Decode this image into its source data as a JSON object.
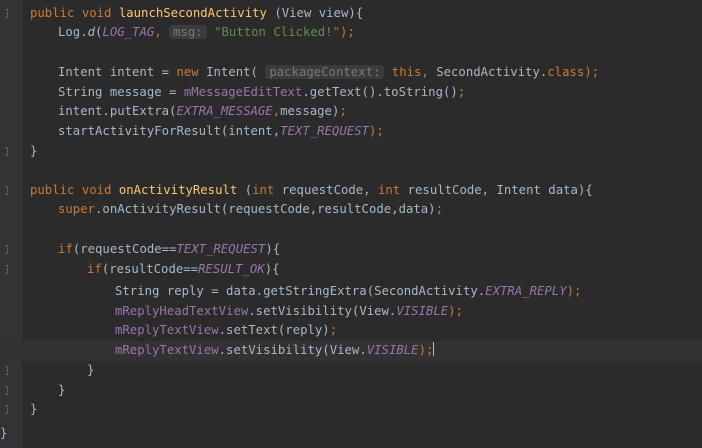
{
  "editor": {
    "lines": [
      [
        {
          "t": "public void ",
          "c": "kw"
        },
        {
          "t": "launchSecondActivity",
          "c": "fn"
        },
        {
          "t": " (View view){",
          "c": "text"
        }
      ],
      [
        {
          "t": "Log.",
          "c": "text"
        },
        {
          "t": "d",
          "c": "ital"
        },
        {
          "t": "(",
          "c": "text"
        },
        {
          "t": "LOG_TAG",
          "c": "const"
        },
        {
          "t": ", ",
          "c": "kw"
        },
        {
          "t": "msg:",
          "c": "hint"
        },
        {
          "t": " ",
          "c": "text"
        },
        {
          "t": "\"Button Clicked!\"",
          "c": "str"
        },
        {
          "t": ");",
          "c": "kw"
        }
      ],
      [],
      [
        {
          "t": "Intent intent = ",
          "c": "text"
        },
        {
          "t": "new ",
          "c": "kw"
        },
        {
          "t": "Intent( ",
          "c": "text"
        },
        {
          "t": "packageContext:",
          "c": "hint"
        },
        {
          "t": " ",
          "c": "text"
        },
        {
          "t": "this, ",
          "c": "kw"
        },
        {
          "t": "SecondActivity.",
          "c": "text"
        },
        {
          "t": "class",
          "c": "kw"
        },
        {
          "t": ");",
          "c": "kw"
        }
      ],
      [
        {
          "t": "String message = ",
          "c": "text"
        },
        {
          "t": "mMessageEditText",
          "c": "field"
        },
        {
          "t": ".getText().toString()",
          "c": "text"
        },
        {
          "t": ";",
          "c": "kw"
        }
      ],
      [
        {
          "t": "intent.putExtra(",
          "c": "text"
        },
        {
          "t": "EXTRA_MESSAGE",
          "c": "const"
        },
        {
          "t": ",",
          "c": "kw"
        },
        {
          "t": "message)",
          "c": "text"
        },
        {
          "t": ";",
          "c": "kw"
        }
      ],
      [
        {
          "t": "startActivityForResult(intent,",
          "c": "text"
        },
        {
          "t": "TEXT_REQUEST",
          "c": "const"
        },
        {
          "t": ");",
          "c": "kw"
        }
      ],
      [
        {
          "t": "}",
          "c": "text"
        }
      ],
      [],
      [
        {
          "t": "public void ",
          "c": "kw"
        },
        {
          "t": "onActivityResult",
          "c": "fn"
        },
        {
          "t": " (",
          "c": "text"
        },
        {
          "t": "int ",
          "c": "kw"
        },
        {
          "t": "requestCode, ",
          "c": "text"
        },
        {
          "t": "int ",
          "c": "kw"
        },
        {
          "t": "resultCode, Intent data){",
          "c": "text"
        }
      ],
      [
        {
          "t": "super",
          "c": "kw"
        },
        {
          "t": ".onActivityResult(requestCode,resultCode,data)",
          "c": "text"
        },
        {
          "t": ";",
          "c": "kw"
        }
      ],
      [],
      [
        {
          "t": "if",
          "c": "kw"
        },
        {
          "t": "(requestCode==",
          "c": "text"
        },
        {
          "t": "TEXT_REQUEST",
          "c": "const"
        },
        {
          "t": "){",
          "c": "text"
        }
      ],
      [
        {
          "t": "if",
          "c": "kw"
        },
        {
          "t": "(resultCode==",
          "c": "text"
        },
        {
          "t": "RESULT_OK",
          "c": "const"
        },
        {
          "t": "){",
          "c": "text"
        }
      ],
      [
        {
          "t": "String reply = data.getStringExtra(SecondActivity.",
          "c": "text"
        },
        {
          "t": "EXTRA_REPLY",
          "c": "const"
        },
        {
          "t": ");",
          "c": "kw"
        }
      ],
      [
        {
          "t": "mReplyHeadTextView",
          "c": "field"
        },
        {
          "t": ".setVisibility(View.",
          "c": "text"
        },
        {
          "t": "VISIBLE",
          "c": "const"
        },
        {
          "t": ");",
          "c": "kw"
        }
      ],
      [
        {
          "t": "mReplyTextView",
          "c": "field"
        },
        {
          "t": ".setText(reply)",
          "c": "text"
        },
        {
          "t": ";",
          "c": "kw"
        }
      ],
      [
        {
          "t": "mReplyTextView",
          "c": "field"
        },
        {
          "t": ".setVisibility(View.",
          "c": "text"
        },
        {
          "t": "VISIBLE",
          "c": "const"
        },
        {
          "t": ");",
          "c": "kw"
        }
      ],
      [
        {
          "t": "}",
          "c": "text"
        }
      ],
      [
        {
          "t": "}",
          "c": "text"
        }
      ],
      [
        {
          "t": "}",
          "c": "text"
        }
      ],
      [
        {
          "t": "}",
          "c": "text"
        }
      ]
    ]
  }
}
